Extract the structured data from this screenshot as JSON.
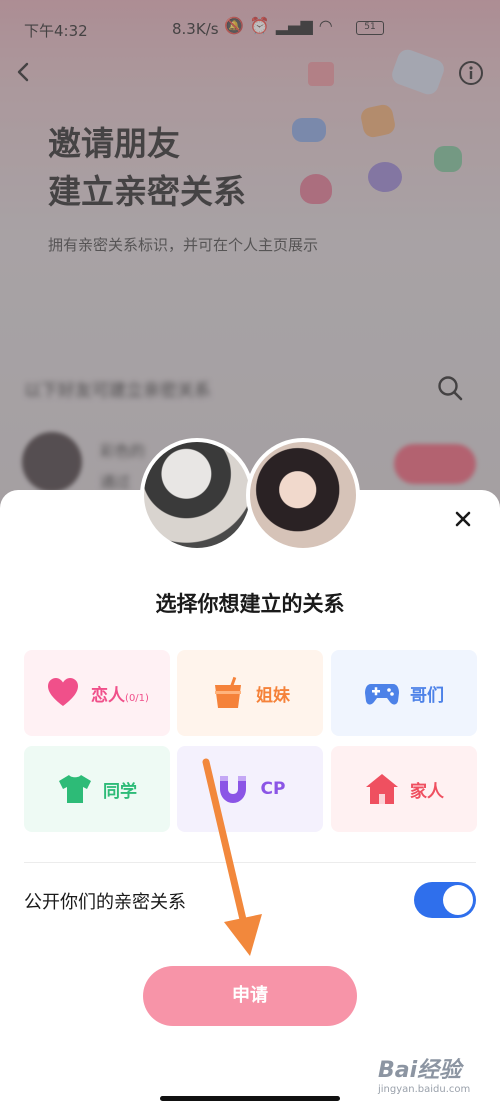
{
  "status_bar": {
    "time": "下午4:32",
    "net_speed": "8.3K/s",
    "battery": "51"
  },
  "header": {
    "title_line1": "邀请朋友",
    "title_line2": "建立亲密关系",
    "subtitle": "拥有亲密关系标识，并可在个人主页展示"
  },
  "friends": {
    "section_label": "以下好友可建立亲密关系",
    "items": [
      {
        "name": "彩色的",
        "status": "通过"
      }
    ]
  },
  "sheet": {
    "title": "选择你想建立的关系",
    "relations": [
      {
        "label": "恋人",
        "sub": "(0/1)",
        "icon": "heart-icon",
        "color": "#f0508a",
        "bg": "#fff1f4"
      },
      {
        "label": "姐妹",
        "sub": "",
        "icon": "cup-icon",
        "color": "#f5823a",
        "bg": "#fff4ec"
      },
      {
        "label": "哥们",
        "sub": "",
        "icon": "gamepad-icon",
        "color": "#4d82e8",
        "bg": "#f0f5fe"
      },
      {
        "label": "同学",
        "sub": "",
        "icon": "shirt-icon",
        "color": "#2dbb77",
        "bg": "#eefaf4"
      },
      {
        "label": "CP",
        "sub": "",
        "icon": "magnet-icon",
        "color": "#8b55e6",
        "bg": "#f4f1fd"
      },
      {
        "label": "家人",
        "sub": "",
        "icon": "house-icon",
        "color": "#ef5060",
        "bg": "#fff1f2"
      }
    ],
    "public_label": "公开你们的亲密关系",
    "public_toggle": "on",
    "apply_label": "申请"
  },
  "watermark": {
    "logo": "Bai经验",
    "url": "jingyan.baidu.com"
  },
  "colors": {
    "accent_blue": "#2f6fec",
    "apply_pink": "#f794a8",
    "arrow_orange": "#f2883c"
  }
}
